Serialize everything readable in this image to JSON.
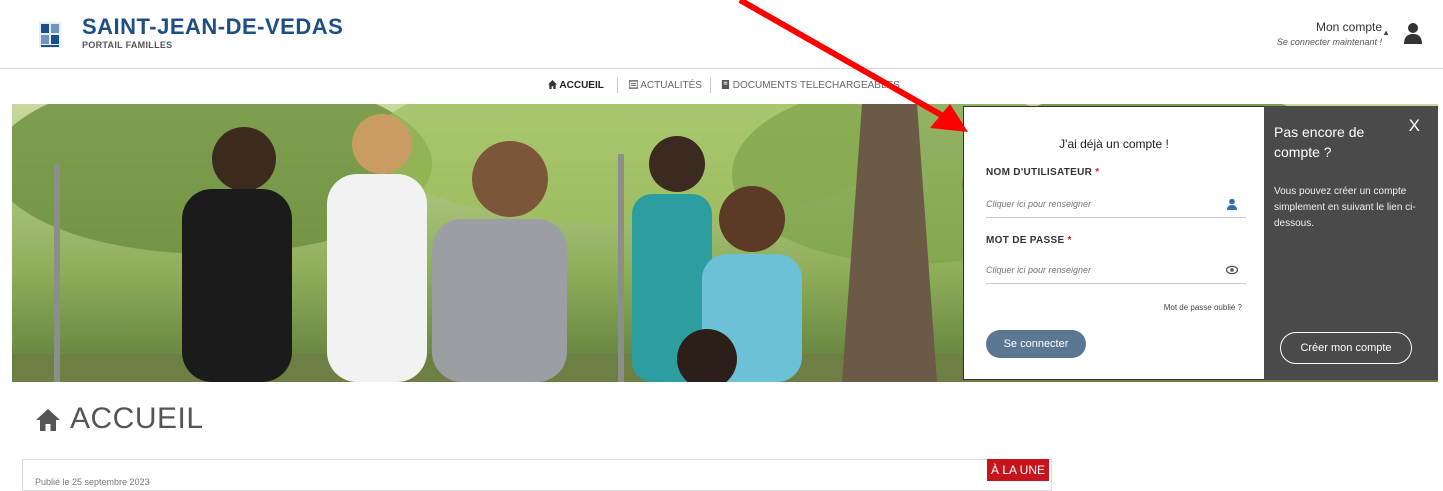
{
  "header": {
    "title": "SAINT-JEAN-DE-VEDAS",
    "subtitle": "PORTAIL FAMILLES",
    "account_title": "Mon compte",
    "account_sub": "Se connecter maintenant !",
    "logo_icon": "city-logo-icon",
    "user_icon": "user-icon"
  },
  "nav": {
    "items": [
      {
        "label": "ACCUEIL",
        "icon": "home-icon",
        "active": true
      },
      {
        "label": "ACTUALITÉS",
        "icon": "news-icon",
        "active": false
      },
      {
        "label": "DOCUMENTS TELECHARGEABLES",
        "icon": "document-icon",
        "active": false
      }
    ]
  },
  "login": {
    "title": "J'ai déjà un compte !",
    "username_label": "NOM D'UTILISATEUR",
    "username_placeholder": "Cliquer ici pour renseigner",
    "password_label": "MOT DE PASSE",
    "password_placeholder": "Cliquer ici pour renseigner",
    "required_mark": "*",
    "forgot_label": "Mot de passe oublié ?",
    "connect_label": "Se connecter"
  },
  "signup": {
    "title": "Pas encore de compte ?",
    "text": "Vous pouvez créer un compte simplement en suivant le lien ci-dessous.",
    "close_label": "X",
    "button_label": "Créer mon compte"
  },
  "page": {
    "heading": "ACCUEIL",
    "card_date": "Publié le 25 septembre 2023",
    "badge": "À LA UNE"
  },
  "colors": {
    "brand": "#1c4f87",
    "button": "#5c7791",
    "side_panel": "#4a4a4a",
    "badge": "#c6141c",
    "annotation_arrow": "#ff0000"
  }
}
